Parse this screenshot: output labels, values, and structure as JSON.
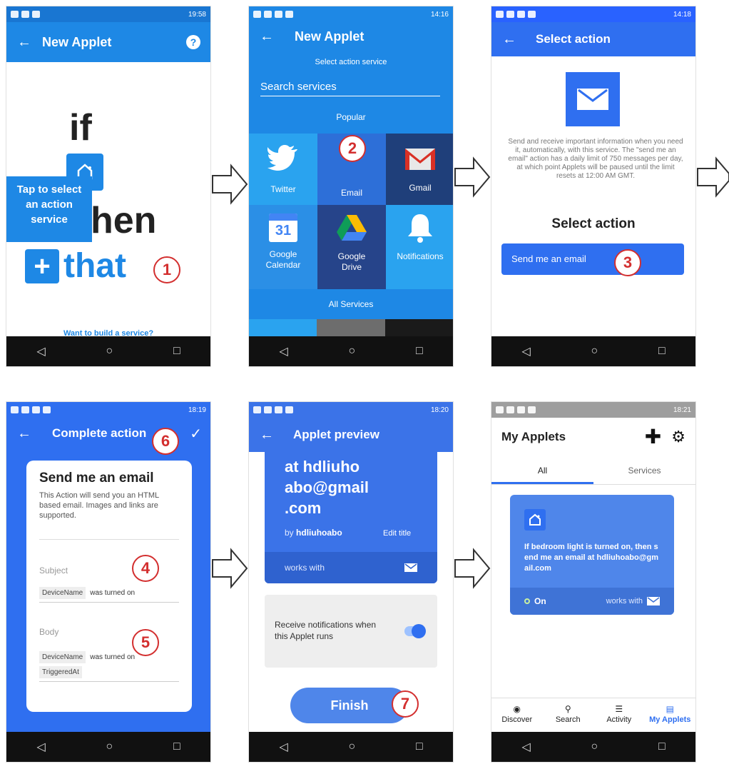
{
  "nav": {
    "back": "◁",
    "home": "○",
    "recent": "□"
  },
  "phone1": {
    "time": "19:58",
    "title": "New Applet",
    "if": "if",
    "then": "hen",
    "that": "that",
    "tooltip": [
      "Tap to select",
      "an action",
      "service"
    ],
    "bottom_link": "Want to build a service?",
    "step": "1"
  },
  "phone2": {
    "time": "14:16",
    "title": "New Applet",
    "subtitle": "Select action service",
    "search_placeholder": "Search services",
    "popular": "Popular",
    "tiles": [
      {
        "label": "Twitter",
        "color": "#2aa3ef"
      },
      {
        "label": "Email",
        "color": "#2d6fd8"
      },
      {
        "label": "Gmail",
        "color": "#1f3f7a"
      },
      {
        "label": "Google Calendar",
        "color": "#2b8fe6"
      },
      {
        "label": "Google Drive",
        "color": "#26448a"
      },
      {
        "label": "Notifications",
        "color": "#2aa3ef"
      }
    ],
    "all_services": "All Services",
    "calendar_day": "31",
    "step": "2"
  },
  "phone3": {
    "time": "14:18",
    "title": "Select action",
    "description": "Send and receive important information when you need it, automatically, with this service. The \"send me an email\" action has a daily limit of 750 messages per day, at which point Applets will be paused until the limit resets at 12:00 AM GMT.",
    "heading": "Select action",
    "action_button": "Send me an email",
    "step": "3"
  },
  "phone4": {
    "time": "18:19",
    "title": "Complete action",
    "card_title": "Send me an email",
    "card_desc": "This Action will send you an HTML based email. Images and links are supported.",
    "subject_label": "Subject",
    "subject_token": "DeviceName",
    "subject_text": "was turned on",
    "body_label": "Body",
    "body_token1": "DeviceName",
    "body_text": "was turned on",
    "body_token2": "TriggeredAt",
    "step_subject": "4",
    "step_body": "5",
    "step_check": "6"
  },
  "phone5": {
    "time": "18:20",
    "title": "Applet preview",
    "applet_text": "at hdliuho abo@gmail .com",
    "by_prefix": "by",
    "author": "hdliuhoabo",
    "edit_title": "Edit title",
    "works_with": "works with",
    "notif_text": "Receive notifications when this Applet runs",
    "finish": "Finish",
    "step": "7"
  },
  "phone6": {
    "time": "18:21",
    "title": "My Applets",
    "tab_all": "All",
    "tab_services": "Services",
    "applet_desc": "If bedroom light is turned on, then send me an email at hdliuhoabo@gmail.com",
    "status": "On",
    "works_with": "works with",
    "bottom_nav": [
      "Discover",
      "Search",
      "Activity",
      "My Applets"
    ]
  }
}
